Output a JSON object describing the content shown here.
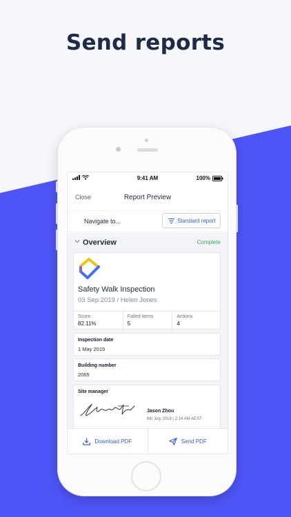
{
  "headline": "Send reports",
  "status_bar": {
    "time": "9:41 AM",
    "battery": "100%"
  },
  "nav": {
    "close_label": "Close",
    "title": "Report Preview"
  },
  "navigate": {
    "label": "Navigate to...",
    "button_label": "Standard report"
  },
  "overview": {
    "title": "Overview",
    "status": "Complete",
    "report_title": "Safety Walk Inspection",
    "report_subtitle": "03 Sep 2019 / Helen Jones",
    "stats": [
      {
        "label": "Score",
        "value": "82.11%"
      },
      {
        "label": "Failed items",
        "value": "5"
      },
      {
        "label": "Actions",
        "value": "4"
      }
    ],
    "fields": [
      {
        "label": "Inspection date",
        "value": "1 May 2019"
      },
      {
        "label": "Building number",
        "value": "2065"
      }
    ],
    "site_manager": {
      "label": "Site manager",
      "name": "Jason Zhou",
      "date": "6th July 2018 | 2:14 AM AEST"
    }
  },
  "actions": {
    "download_label": "Download PDF",
    "send_label": "Send PDF"
  },
  "colors": {
    "accent": "#2f5cd9",
    "complete": "#39a463",
    "background_blue": "#4f54f6"
  }
}
